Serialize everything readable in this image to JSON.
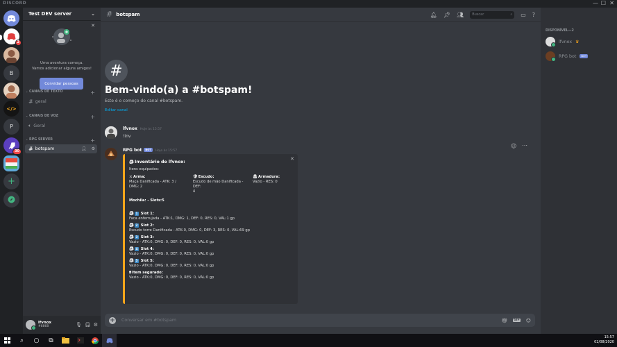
{
  "titlebar": {
    "brand": "DISCORD",
    "min": "—",
    "max": "☐",
    "close": "✕"
  },
  "rail": {
    "servers": [
      {
        "label": "",
        "badge": "2"
      },
      {
        "label": "",
        "badge": ""
      },
      {
        "label": "B",
        "badge": ""
      },
      {
        "label": "",
        "badge": ""
      },
      {
        "label": "</>",
        "badge": ""
      },
      {
        "label": "P",
        "badge": ""
      },
      {
        "label": "",
        "badge": "30"
      },
      {
        "label": "",
        "badge": ""
      }
    ]
  },
  "sidebar": {
    "server_name": "Test DEV server",
    "invite_text_1": "Uma aventura começa.",
    "invite_text_2": "Vamos adicionar alguns amigos!",
    "invite_button": "Convidar pessoas",
    "categories": {
      "text": "CANAIS DE TEXTO",
      "voice": "CANAIS DE VOZ",
      "rpg": "RPG SERVER"
    },
    "channels": {
      "geral_text": "geral",
      "geral_voice": "Geral",
      "botspam": "botspam"
    },
    "user": {
      "name": "lfvnox",
      "tag": "#8868"
    }
  },
  "header": {
    "channel": "botspam",
    "search_placeholder": "Buscar"
  },
  "welcome": {
    "title": "Bem-vindo(a) a #botspam!",
    "subtitle": "Este é o começo do canal #botspam.",
    "edit_link": "Editar canal"
  },
  "messages": [
    {
      "author": "lfvnox",
      "time": "Hoje às 15:57",
      "text": "!inv"
    },
    {
      "author": "RPG bot",
      "bot_tag": "BOT",
      "time": "Hoje às 15:57"
    }
  ],
  "embed": {
    "title": "Inventário de lfvnox:",
    "description": "Itens equipados:",
    "fields": [
      {
        "name": "Arma:",
        "value_1": "Maça Danificada - ATK: 3 /",
        "value_2": "DMG: 2"
      },
      {
        "name": "Escudo:",
        "value_1": "Escudo de mão Danificada - DEF:",
        "value_2": "4"
      },
      {
        "name": "Armadura:",
        "value_1": "Vazio - RES: 0",
        "value_2": ""
      }
    ],
    "backpack": "Mochila: - Slots:5",
    "slots": [
      {
        "num": "1",
        "name": "Slot 1:",
        "value": "Faca enferrujada - ATK:1, DMG: 1, DEF: 0, RES: 0, VAL:1 gp"
      },
      {
        "num": "2",
        "name": "Slot 2:",
        "value": "Escudo torre Danificada - ATK:0, DMG: 0, DEF: 3, RES: 0, VAL:69 gp"
      },
      {
        "num": "3",
        "name": "Slot 3:",
        "value": "Vazio - ATK:0, DMG: 0, DEF: 0, RES: 0, VAL:0 gp"
      },
      {
        "num": "4",
        "name": "Slot 4:",
        "value": "Vazio - ATK:0, DMG: 0, DEF: 0, RES: 0, VAL:0 gp"
      },
      {
        "num": "5",
        "name": "Slot 5:",
        "value": "Vazio - ATK:0, DMG: 0, DEF: 0, RES: 0, VAL:0 gp"
      }
    ],
    "held": {
      "name": "Item segurado:",
      "value": "Vazio - ATK:0, DMG: 0, DEF: 0, RES: 0, VAL:0 gp"
    }
  },
  "composer": {
    "placeholder": "Conversar em #botspam",
    "gif": "GIF"
  },
  "members": {
    "heading": "DISPONÍVEL—2",
    "list": [
      {
        "name": "lfvnox",
        "crown": "♛"
      },
      {
        "name": "RPG bot",
        "bot_tag": "BOT"
      }
    ]
  },
  "taskbar": {
    "time": "15:57",
    "date": "02/08/2020"
  }
}
